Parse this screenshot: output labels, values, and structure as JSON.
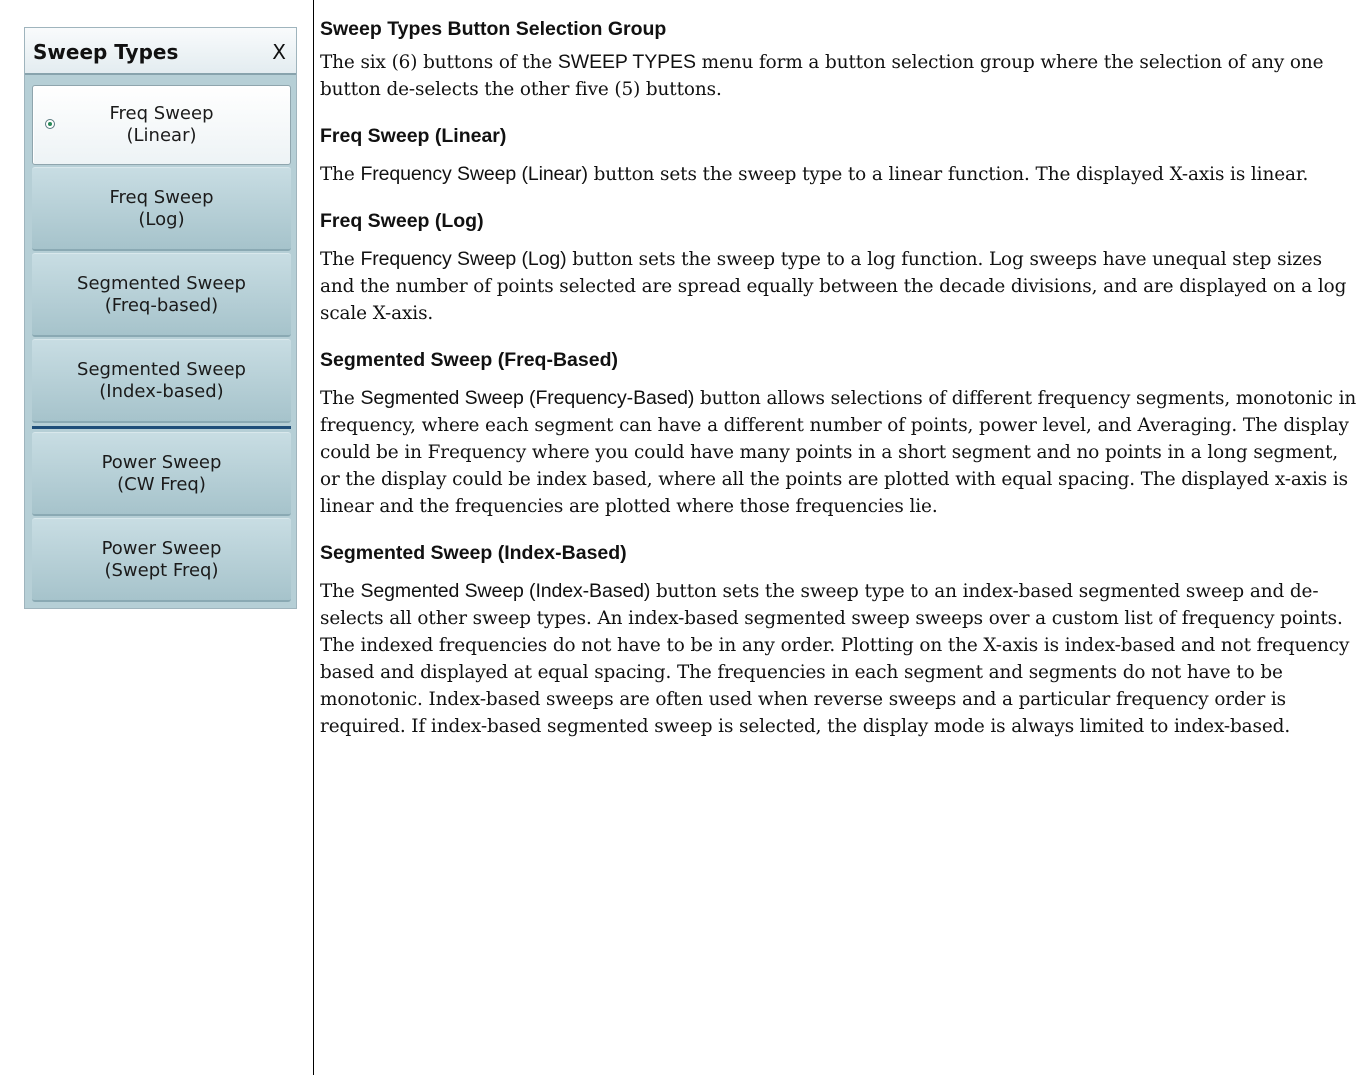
{
  "menu": {
    "title": "Sweep Types",
    "close_label": "X",
    "buttons": [
      {
        "line1": "Freq Sweep",
        "line2": "(Linear)",
        "selected": true
      },
      {
        "line1": "Freq Sweep",
        "line2": "(Log)",
        "selected": false
      },
      {
        "line1": "Segmented Sweep",
        "line2": "(Freq-based)",
        "selected": false
      },
      {
        "line1": "Segmented Sweep",
        "line2": "(Index-based)",
        "selected": false
      },
      {
        "line1": "Power Sweep",
        "line2": "(CW Freq)",
        "selected": false
      },
      {
        "line1": "Power Sweep",
        "line2": "(Swept Freq)",
        "selected": false
      }
    ]
  },
  "content": {
    "section_group": {
      "heading": "Sweep Types Button Selection Group",
      "p1_a": "The six (6) buttons of the ",
      "p1_ui": "SWEEP TYPES",
      "p1_b": " menu form a button selection group where the selection of any one button de-selects the other five (5) buttons."
    },
    "section_linear": {
      "heading": "Freq Sweep (Linear)",
      "p_a": "The ",
      "p_ui": "Frequency Sweep (Linear)",
      "p_b": " button sets the sweep type to a linear function. The displayed X-axis is linear."
    },
    "section_log": {
      "heading": "Freq Sweep (Log)",
      "p_a": "The ",
      "p_ui": "Frequency Sweep (Log)",
      "p_b": " button sets the sweep type to a log function. Log sweeps have unequal step sizes and the number of points selected are spread equally between the decade divisions, and are displayed on a log scale X-axis."
    },
    "section_freqbased": {
      "heading": "Segmented Sweep (Freq-Based)",
      "p_a": "The ",
      "p_ui": "Segmented Sweep (Frequency-Based)",
      "p_b": " button allows selections of different frequency segments, monotonic in frequency, where each segment can have a different number of points, power level, and Averaging. The display could be in Frequency where you could have many points in a short segment and no points in a long segment, or the display could be index based, where all the points are plotted with equal spacing. The displayed x-axis is linear and the frequencies are plotted where those frequencies lie."
    },
    "section_indexbased": {
      "heading": "Segmented Sweep (Index-Based)",
      "p_a": "The ",
      "p_ui": "Segmented Sweep (Index-Based)",
      "p_b": " button sets the sweep type to an index-based segmented sweep and de-selects all other sweep types. An index-based segmented sweep sweeps over a custom list of frequency points. The indexed frequencies do not have to be in any order. Plotting on the X-axis is index-based and not frequency based and displayed at equal spacing. The frequencies in each segment and segments do not have to be monotonic. Index-based sweeps are often used when reverse sweeps and a particular frequency order is required. If index-based segmented sweep is selected, the display mode is always limited to index-based."
    }
  }
}
